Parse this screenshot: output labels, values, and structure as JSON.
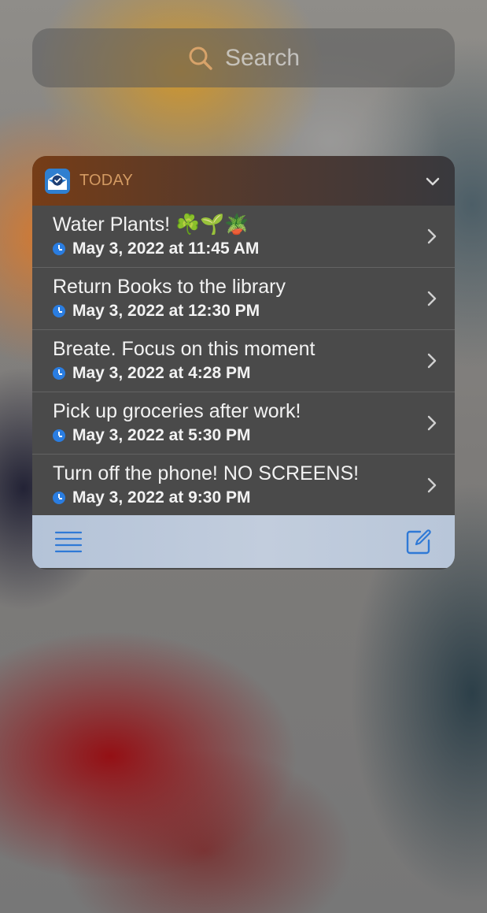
{
  "search": {
    "label": "Search",
    "icon": "search-icon"
  },
  "widget": {
    "title": "TODAY",
    "app_icon": "mail-clock-app-icon",
    "collapse_icon": "chevron-down-icon",
    "items": [
      {
        "title": "Water Plants! ☘️🌱🪴",
        "time": "May 3, 2022 at 11:45 AM"
      },
      {
        "title": "Return Books to the library",
        "time": "May 3, 2022 at 12:30 PM"
      },
      {
        "title": "Breate. Focus on this moment",
        "time": "May 3, 2022 at 4:28 PM"
      },
      {
        "title": "Pick up groceries after work!",
        "time": "May 3, 2022 at 5:30 PM"
      },
      {
        "title": "Turn off the phone! NO SCREENS!",
        "time": "May 3, 2022 at 9:30 PM"
      }
    ],
    "footer": {
      "list_icon": "list-icon",
      "compose_icon": "compose-icon"
    }
  },
  "colors": {
    "accent": "#2a7de1",
    "title_color": "#d39a62"
  }
}
